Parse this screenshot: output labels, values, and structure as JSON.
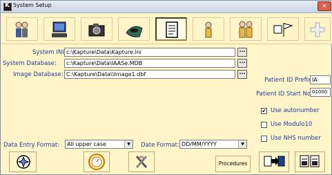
{
  "window": {
    "title": "System Setup",
    "close_glyph": "×"
  },
  "toolbar": {
    "buttons": [
      {
        "name": "users",
        "icon": "people-icon"
      },
      {
        "name": "computer",
        "icon": "computer-icon"
      },
      {
        "name": "camera",
        "icon": "camera-icon"
      },
      {
        "name": "eye",
        "icon": "eye-icon"
      },
      {
        "name": "document",
        "icon": "document-icon"
      },
      {
        "name": "person",
        "icon": "person-icon"
      },
      {
        "name": "group",
        "icon": "group-icon"
      },
      {
        "name": "flag",
        "icon": "flag-icon"
      },
      {
        "name": "add",
        "icon": "plus-icon"
      }
    ],
    "active_index": 4
  },
  "form": {
    "system_ini_label": "System INI:",
    "system_ini_value": "c:\\Kapture\\Data\\Kapture.ini",
    "system_db_label": "System Database:",
    "system_db_value": "c:\\Kapture\\Data\\IAASe.MDB",
    "image_db_label": "Image Database:",
    "image_db_value": "C:\\Kapture\\Data\\\\Image1.dbf",
    "browse_glyph": "...",
    "patient_id_prefix_label": "Patient ID Prefix:",
    "patient_id_prefix_value": "IA",
    "patient_id_start_label": "Patient ID Start No.:",
    "patient_id_start_value": "01000",
    "use_autonumber_label": "Use autonumber",
    "use_autonumber_checked": true,
    "use_modulo10_label": "Use Modulo10",
    "use_modulo10_checked": false,
    "use_nhs_label": "Use NHS number",
    "use_nhs_checked": false,
    "check_glyph": "✔",
    "data_entry_label": "Data Entry Format:",
    "data_entry_value": "All upper case",
    "date_format_label": "Date Format:",
    "date_format_value": "DD/MM/YYYY",
    "dropdown_glyph": "▼"
  },
  "bottom": {
    "procedures_label": "Procedures"
  }
}
